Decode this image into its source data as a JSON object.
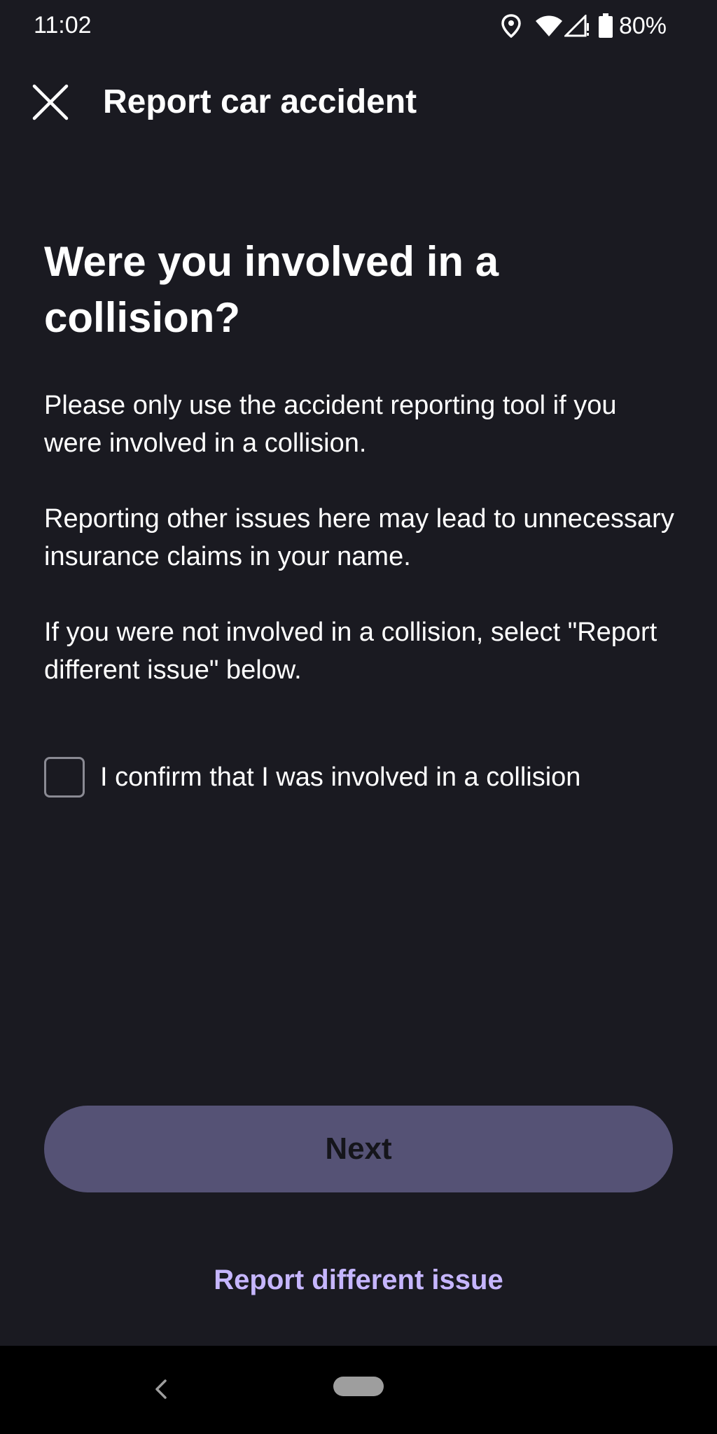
{
  "status_bar": {
    "time": "11:02",
    "battery": "80%",
    "icons": [
      "location-icon",
      "wifi-icon",
      "cellular-signal-icon",
      "battery-icon"
    ]
  },
  "top_bar": {
    "title": "Report car accident",
    "close_icon": "close-icon"
  },
  "content": {
    "heading": "Were you involved in a collision?",
    "paragraphs": [
      "Please only use the accident reporting tool if you were involved in a collision.",
      "Reporting other issues here may lead to unnecessary insurance claims in your name.",
      "If you were not involved in a collision, select \"Report different issue\" below."
    ],
    "confirm_checkbox": {
      "label": "I confirm that I was involved in a collision",
      "checked": false
    }
  },
  "actions": {
    "next_label": "Next",
    "different_issue_label": "Report different issue"
  },
  "nav_bar": {
    "back_icon": "back-chevron-icon",
    "home_icon": "home-pill-icon"
  },
  "colors": {
    "background": "#1a1a21",
    "button_disabled": "#555275",
    "link_accent": "#c6b6ff"
  }
}
